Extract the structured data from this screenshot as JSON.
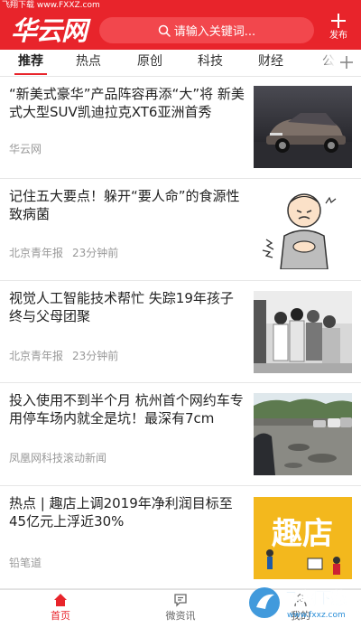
{
  "status": {
    "corner_label": "飞翔下载 www.FXXZ.com"
  },
  "header": {
    "logo_text": "华云网",
    "search_placeholder": "请输入关键词...",
    "publish_label": "发布",
    "brand_color": "#e8242b"
  },
  "tabs": [
    {
      "label": "推荐",
      "active": true
    },
    {
      "label": "热点",
      "active": false
    },
    {
      "label": "原创",
      "active": false
    },
    {
      "label": "科技",
      "active": false
    },
    {
      "label": "财经",
      "active": false
    },
    {
      "label": "公",
      "active": false
    }
  ],
  "news": [
    {
      "title": "“新美式豪华”产品阵容再添“大”将 新美式大型SUV凯迪拉克XT6亚洲首秀",
      "source": "华云网",
      "time": "",
      "thumb": "car-photo"
    },
    {
      "title": "记住五大要点！躲开“要人命”的食源性致病菌",
      "source": "北京青年报",
      "time": "23分钟前",
      "thumb": "sick-man-cartoon"
    },
    {
      "title": "视觉人工智能技术帮忙 失踪19年孩子终与父母团聚",
      "source": "北京青年报",
      "time": "23分钟前",
      "thumb": "family-reunion-photo"
    },
    {
      "title": "投入使用不到半个月 杭州首个网约车专用停车场内就全是坑！最深有7cm",
      "source": "凤凰网科技滚动新闻",
      "time": "",
      "thumb": "parking-lot-photo"
    },
    {
      "title": "热点 | 趣店上调2019年净利润目标至45亿元上浮近30%",
      "source": "铅笔道",
      "time": "",
      "thumb": "qudian-logo"
    }
  ],
  "bottom_nav": [
    {
      "label": "首页",
      "icon": "home-icon",
      "active": true
    },
    {
      "label": "微资讯",
      "icon": "chat-icon",
      "active": false
    },
    {
      "label": "我的",
      "icon": "user-icon",
      "active": false
    }
  ],
  "watermark": {
    "text": "飞翔下载",
    "url": "www.fxxz.com"
  }
}
